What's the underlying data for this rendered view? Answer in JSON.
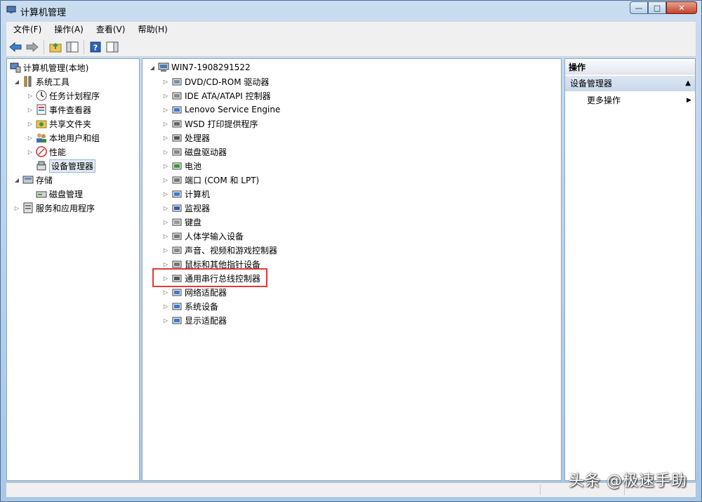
{
  "window": {
    "title": "计算机管理"
  },
  "menubar": {
    "items": [
      "文件(F)",
      "操作(A)",
      "查看(V)",
      "帮助(H)"
    ]
  },
  "toolbar": {
    "buttons": [
      "back-arrow-icon",
      "forward-arrow-icon",
      "up-folder-icon",
      "show-hide-tree-icon",
      "help-icon",
      "show-hide-action-pane-icon"
    ]
  },
  "left_tree": {
    "root": "计算机管理(本地)",
    "system_tools": "系统工具",
    "task_scheduler": "任务计划程序",
    "event_viewer": "事件查看器",
    "shared_folders": "共享文件夹",
    "local_users": "本地用户和组",
    "performance": "性能",
    "device_manager": "设备管理器",
    "storage": "存储",
    "disk_management": "磁盘管理",
    "services_apps": "服务和应用程序"
  },
  "device_tree": {
    "computer_name": "WIN7-1908291522",
    "categories": [
      "DVD/CD-ROM 驱动器",
      "IDE ATA/ATAPI 控制器",
      "Lenovo Service Engine",
      "WSD 打印提供程序",
      "处理器",
      "磁盘驱动器",
      "电池",
      "端口 (COM 和 LPT)",
      "计算机",
      "监视器",
      "键盘",
      "人体学输入设备",
      "声音、视频和游戏控制器",
      "鼠标和其他指针设备",
      "通用串行总线控制器",
      "网络适配器",
      "系统设备",
      "显示适配器"
    ]
  },
  "actions": {
    "header": "操作",
    "section": "设备管理器",
    "more": "更多操作"
  },
  "watermark": "头条 @极速手助"
}
